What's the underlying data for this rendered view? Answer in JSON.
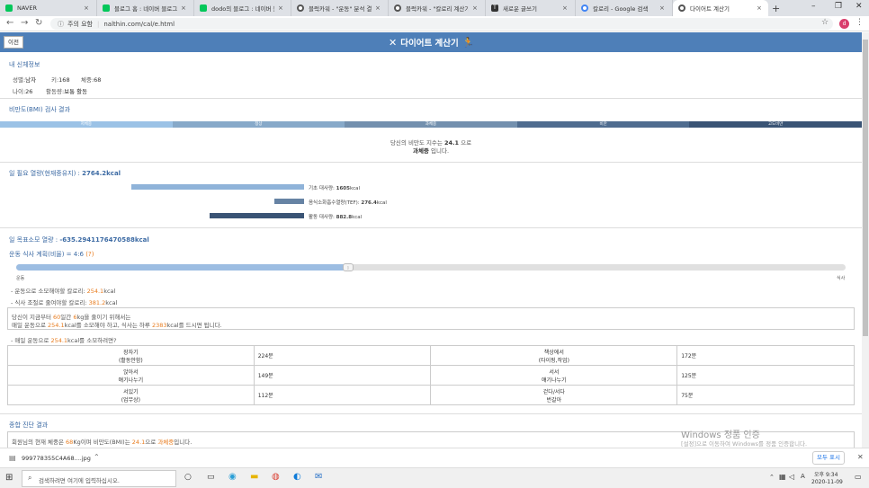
{
  "browser": {
    "tabs": [
      {
        "label": "NAVER",
        "color": "#03c75a"
      },
      {
        "label": "블로그 홈 : 네이버 블로그",
        "color": "#03c75a"
      },
      {
        "label": "dodo의 블로그 : 네이버 블",
        "color": "#03c75a"
      },
      {
        "label": "블럭카워 - \"운동\" 분석 결",
        "color": "#555555"
      },
      {
        "label": "블럭카워 - \"칼로리 계산기",
        "color": "#555555"
      },
      {
        "label": "새로운 글쓰기",
        "color": "#333333"
      },
      {
        "label": "칼로리 - Google 검색",
        "color": "#4285f4"
      },
      {
        "label": "다이어트 계산기",
        "color": "#555555"
      }
    ],
    "security": "주의 요함",
    "url": "nalthin.com/cal/e.html",
    "profile_initial": "d"
  },
  "header": {
    "prev_label": "이전",
    "title": "다이어트 계산기"
  },
  "profile": {
    "section_title": "내 신체정보",
    "gender_label": "성별:",
    "gender_value": "남자",
    "height_label": "키:",
    "height_value": "168",
    "weight_label": "체중:",
    "weight_value": "68",
    "age_label": "나이:",
    "age_value": "26",
    "activity_label": "활동량:",
    "activity_value": "보통 활동"
  },
  "bmi": {
    "section_title": "비만도(BMI) 검사 결과",
    "categories": [
      {
        "label": "저체중",
        "color": "#9bc2e6"
      },
      {
        "label": "정상",
        "color": "#87a9c9"
      },
      {
        "label": "과체중",
        "color": "#7390ae"
      },
      {
        "label": "비만",
        "color": "#4f6c8f"
      },
      {
        "label": "고도비만",
        "color": "#3a5475"
      }
    ],
    "text_prefix": "당신의 비만도 지수는",
    "value": "24.1",
    "text_suffix": "으로",
    "result": "과체중",
    "result_suffix": "입니다."
  },
  "energy": {
    "section_title": "일 필요 열량(현재중유지) :",
    "total": "2764.2kcal",
    "rows": [
      {
        "label": "기초 대사량:",
        "value": "1605",
        "unit": "kcal",
        "fraction": 0.581,
        "color": "#8fb3d9"
      },
      {
        "label": "음식소화흡수열량(TEF):",
        "value": "276.4",
        "unit": "kcal",
        "fraction": 0.1,
        "color": "#6683a4"
      },
      {
        "label": "활동 대사량:",
        "value": "882.8",
        "unit": "kcal",
        "fraction": 0.319,
        "color": "#3a5475"
      }
    ]
  },
  "goal": {
    "section_title": "일 목표소모 열량 :",
    "value": "-635.2941176470588kcal",
    "plan_label": "운동 식사 계획(비율) = 4:6",
    "plan_hint": "(?)",
    "ratio": 0.4,
    "slider_left": "운동",
    "slider_right": "식사",
    "exercise_line_prefix": "- 운동으로 소모해야할 칼로리:",
    "exercise_kcal": "254.1",
    "kcal": "kcal",
    "diet_line_prefix": "- 식사 조절로 줄여야할 칼로리:",
    "diet_kcal": "381.2",
    "summary": {
      "a1": "당신이 지금부터",
      "days": "60",
      "a2": "일간",
      "kg": "6",
      "a3": "kg을 줄이기 위해서는",
      "b1": "매일 운동으로",
      "b_kcal": "254.1",
      "b2": "kcal를 소모해야 하고, 식사는 하루",
      "meal": "2383",
      "b3": "kcal를 드시면 됩니다."
    },
    "daily_prefix": "- 매일 운동으로",
    "daily_kcal": "254.1",
    "daily_suffix": "kcal를 소모하려면?"
  },
  "exercise_table": [
    [
      "장자기\n(활동안함)",
      "224분",
      "책상에서\n(타이핑,작업)",
      "172분"
    ],
    [
      "앉아서\n얘기나누기",
      "149분",
      "서서\n얘기나누기",
      "125분"
    ],
    [
      "서있기\n(업무상)",
      "112분",
      "걷다/서다\n번갈아",
      "75분"
    ]
  ],
  "diagnosis": {
    "section_title": "종합 진단 결과",
    "t1": "회원님의 현재 체중은",
    "kg": "68",
    "t2": "Kg이며 비만도(BMI)는",
    "bmi": "24.1",
    "t3": "으로",
    "result": "과체중",
    "t4": "입니다."
  },
  "watermark": {
    "title": "Windows 정품 인증",
    "sub": "[설정]으로 이동하여 Windows를 정품 인증합니다."
  },
  "download": {
    "file": "999778355C4A68....jpg",
    "show_all": "모두 표시"
  },
  "taskbar": {
    "search_placeholder": "검색하려면 여기에 입력하십시오.",
    "time": "오후 9:34",
    "date": "2020-11-09",
    "ime": "A"
  }
}
